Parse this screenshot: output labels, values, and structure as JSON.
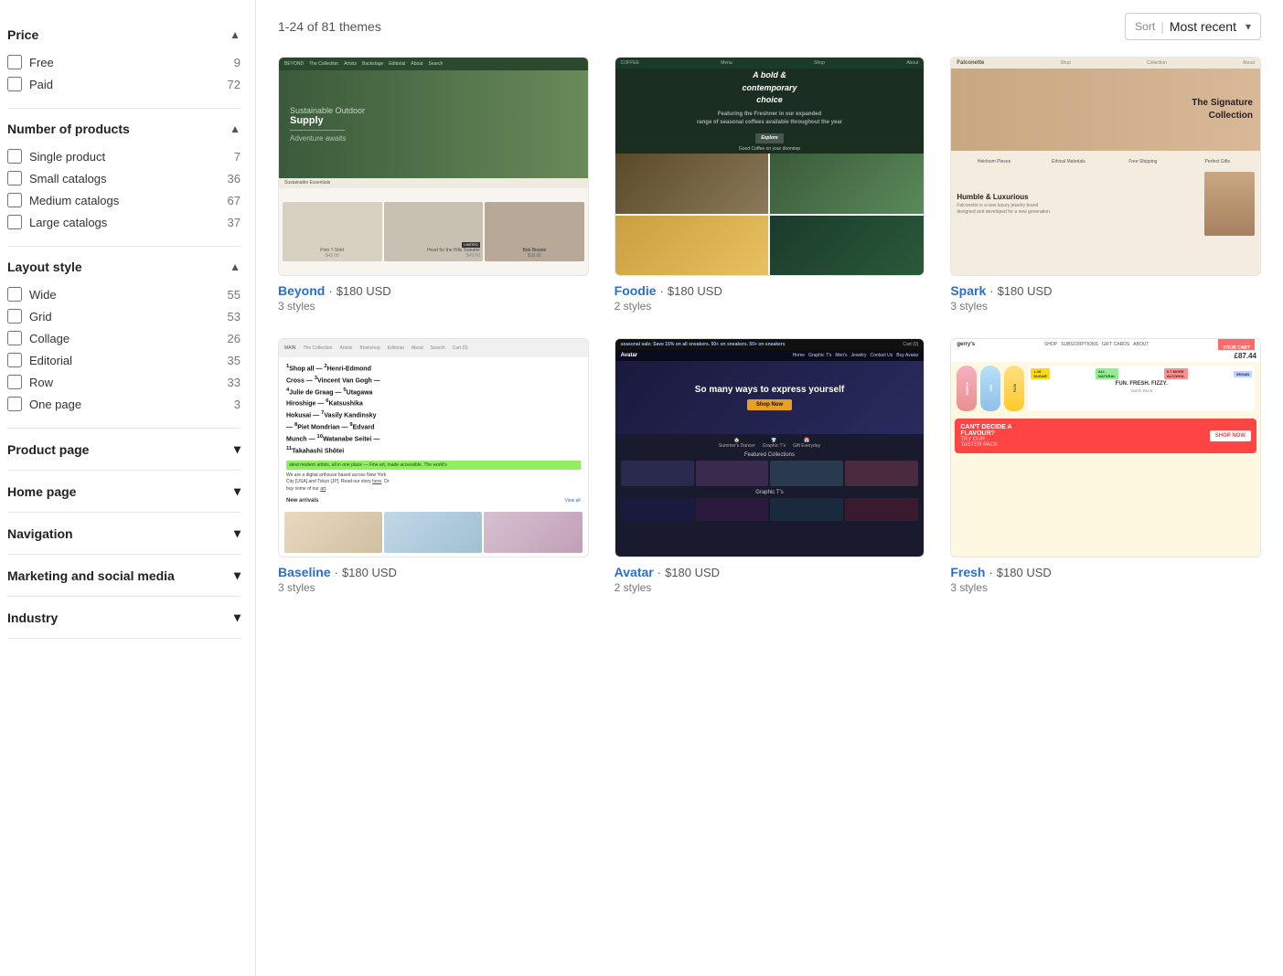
{
  "sidebar": {
    "price_label": "Price",
    "price_options": [
      {
        "label": "Free",
        "count": 9,
        "checked": false
      },
      {
        "label": "Paid",
        "count": 72,
        "checked": false
      }
    ],
    "number_of_products_label": "Number of products",
    "number_of_products_options": [
      {
        "label": "Single product",
        "count": 7,
        "checked": false
      },
      {
        "label": "Small catalogs",
        "count": 36,
        "checked": false
      },
      {
        "label": "Medium catalogs",
        "count": 67,
        "checked": false
      },
      {
        "label": "Large catalogs",
        "count": 37,
        "checked": false
      }
    ],
    "layout_style_label": "Layout style",
    "layout_style_options": [
      {
        "label": "Wide",
        "count": 55,
        "checked": false
      },
      {
        "label": "Grid",
        "count": 53,
        "checked": false
      },
      {
        "label": "Collage",
        "count": 26,
        "checked": false
      },
      {
        "label": "Editorial",
        "count": 35,
        "checked": false
      },
      {
        "label": "Row",
        "count": 33,
        "checked": false
      },
      {
        "label": "One page",
        "count": 3,
        "checked": false
      }
    ],
    "product_page_label": "Product page",
    "home_page_label": "Home page",
    "navigation_label": "Navigation",
    "marketing_label": "Marketing and social media",
    "industry_label": "Industry"
  },
  "header": {
    "results_count": "1-24 of 81 themes",
    "sort_label": "Sort",
    "sort_value": "Most recent"
  },
  "themes": [
    {
      "name": "Beyond",
      "separator": "·",
      "price": "$180 USD",
      "styles": "3 styles",
      "preview_type": "beyond"
    },
    {
      "name": "Foodie",
      "separator": "·",
      "price": "$180 USD",
      "styles": "2 styles",
      "preview_type": "foodie"
    },
    {
      "name": "Spark",
      "separator": "·",
      "price": "$180 USD",
      "styles": "3 styles",
      "preview_type": "spark"
    },
    {
      "name": "Baseline",
      "separator": "·",
      "price": "$180 USD",
      "styles": "3 styles",
      "preview_type": "baseline"
    },
    {
      "name": "Avatar",
      "separator": "·",
      "price": "$180 USD",
      "styles": "2 styles",
      "preview_type": "avatar"
    },
    {
      "name": "Fresh",
      "separator": "·",
      "price": "$180 USD",
      "styles": "3 styles",
      "preview_type": "fresh"
    }
  ],
  "icons": {
    "chevron_up": "▲",
    "chevron_down": "▾",
    "sort_arrow": "▾"
  }
}
